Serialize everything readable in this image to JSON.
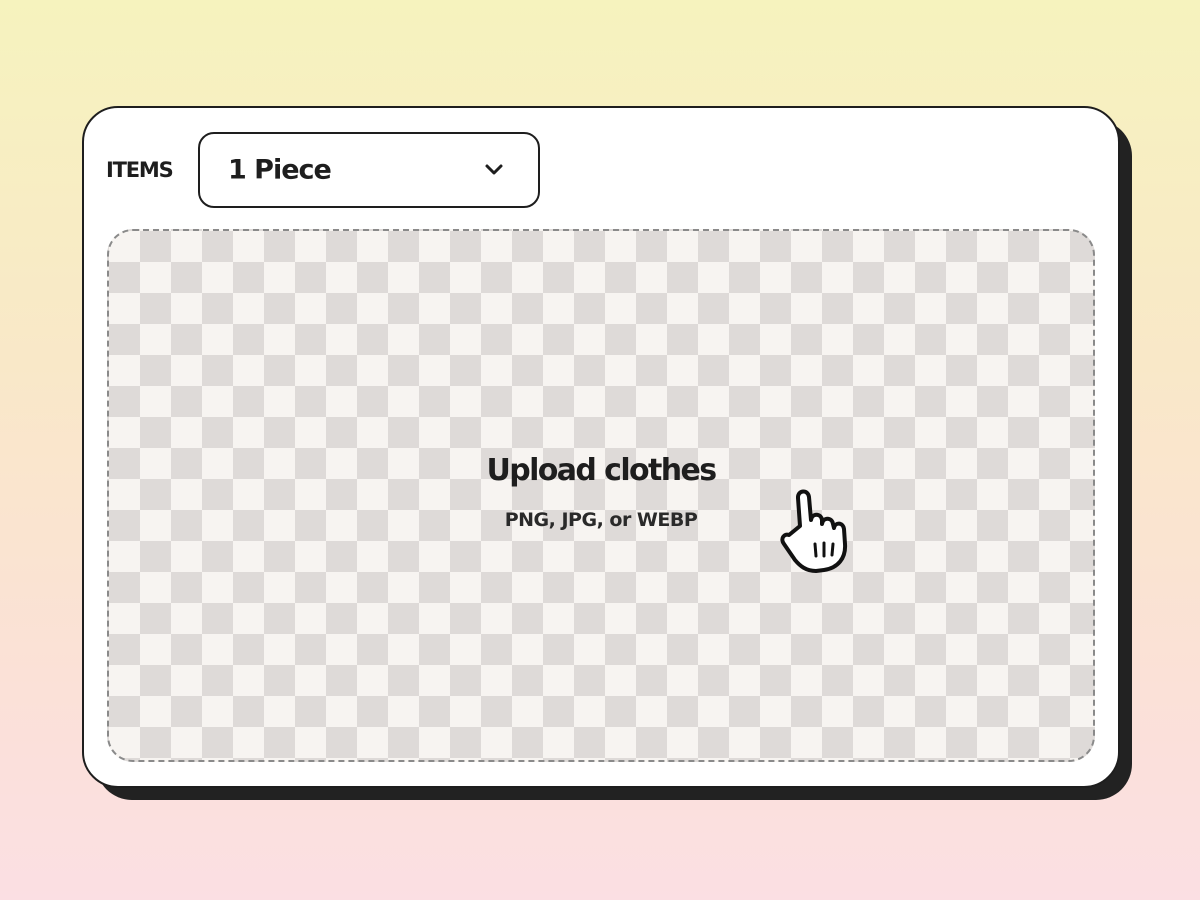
{
  "items_label": "ITEMS",
  "select": {
    "value": "1 Piece"
  },
  "dropzone": {
    "title": "Upload clothes",
    "subtitle": "PNG, JPG, or WEBP"
  },
  "icons": {
    "chevron": "chevron-down-icon",
    "cursor": "pointer-hand-icon"
  },
  "colors": {
    "ink": "#1e1e1e",
    "card": "#ffffff",
    "checker_light": "#f7f4f1",
    "checker_dark": "#dedad8",
    "bg_top": "#f6f3be",
    "bg_bottom": "#fbdfe3"
  }
}
